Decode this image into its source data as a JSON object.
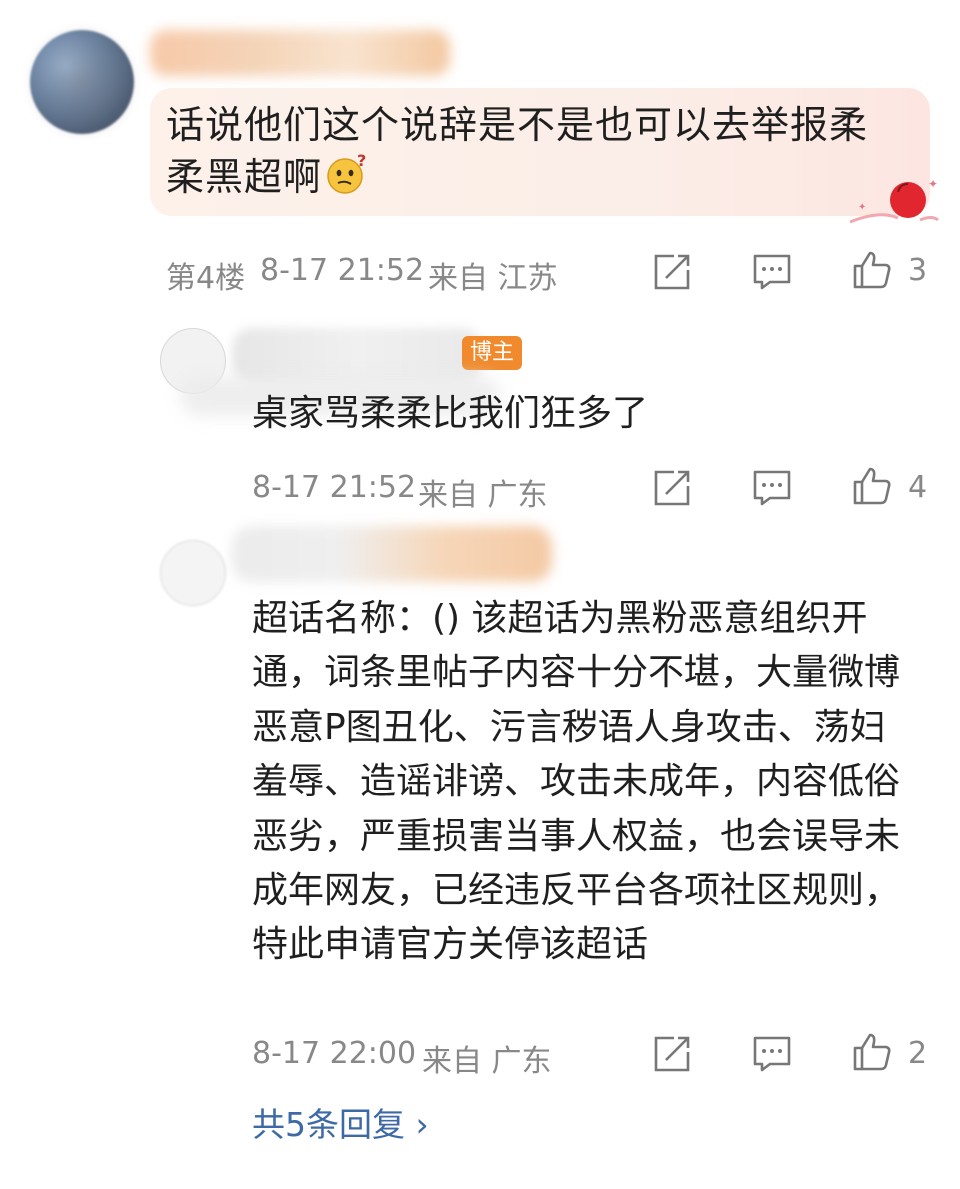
{
  "main_comment": {
    "text_line1": "话说他们这个说辞是不是也可以去举报柔",
    "text_line2": "柔黑超啊",
    "emoji": "thinking-face-emoji",
    "floor": "第4楼",
    "timestamp": "8-17 21:52",
    "location": "来自 江苏",
    "like_count": "3"
  },
  "replies": [
    {
      "badge": "博主",
      "text": "桌家骂柔柔比我们狂多了",
      "timestamp": "8-17 21:52",
      "location": "来自 广东",
      "like_count": "4"
    },
    {
      "text": "超话名称：() 该超话为黑粉恶意组织开通，词条里帖子内容十分不堪，大量微博恶意P图丑化、污言秽语人身攻击、荡妇羞辱、造谣诽谤、攻击未成年，内容低俗恶劣，严重损害当事人权益，也会误导未成年网友，已经违反平台各项社区规则，特此申请官方关停该超话",
      "timestamp": "8-17 22:00",
      "location": "来自 广东",
      "like_count": "2"
    }
  ],
  "more_replies": "共5条回复 ›",
  "colors": {
    "link": "#3d6aa6",
    "meta": "#888888",
    "badge": "#f08a2d"
  }
}
